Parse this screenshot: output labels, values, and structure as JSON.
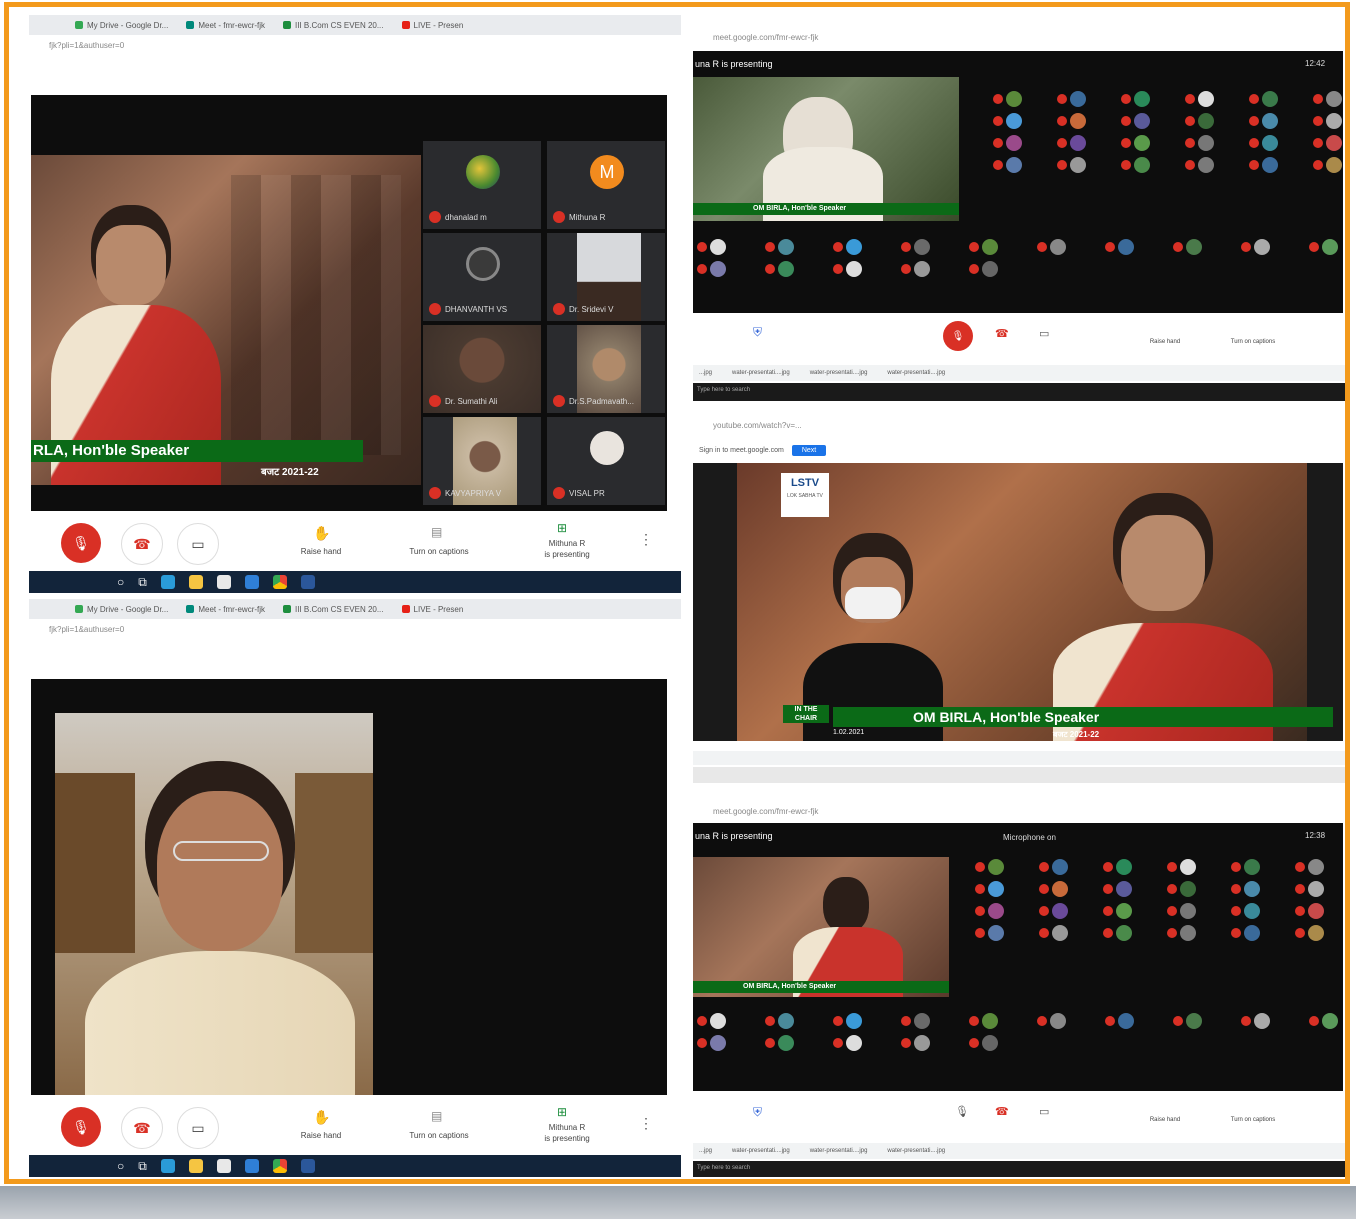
{
  "top_left": {
    "tabs": [
      {
        "label": "My Drive - Google Dr..."
      },
      {
        "label": "Meet - fmr-ewcr-fjk"
      },
      {
        "label": "III B.Com CS EVEN 20..."
      },
      {
        "label": "LIVE - Presen"
      }
    ],
    "url": "fjk?pli=1&authuser=0",
    "banner": "RLA, Hon'ble Speaker",
    "banner_sub": "बजट 2021-22",
    "participants": [
      {
        "name": "dhanalad m",
        "avatar": "globe-avatar",
        "color": "#4a8a2f"
      },
      {
        "name": "Mithuna R",
        "avatar": "letter-avatar",
        "letter": "M",
        "color": "#f28b1e"
      },
      {
        "name": "DHANVANTH VS",
        "avatar": "logo-avatar",
        "color": "#777"
      },
      {
        "name": "Dr. Sridevi V",
        "avatar": "photo-avatar",
        "color": "#8a7a66"
      },
      {
        "name": "Dr. Sumathi Ali",
        "avatar": "photo-avatar",
        "color": "#6a4a3a"
      },
      {
        "name": "Dr.S.Padmavath...",
        "avatar": "photo-avatar",
        "color": "#b08a6a"
      },
      {
        "name": "KAVYAPRIYA V",
        "avatar": "photo-avatar",
        "color": "#c8b8a0"
      },
      {
        "name": "VISAL PR",
        "avatar": "cartoon-avatar",
        "color": "#e9e4de"
      }
    ],
    "controls": {
      "raise_hand": "Raise hand",
      "captions": "Turn on captions",
      "presenting_line1": "Mithuna R",
      "presenting_line2": "is presenting"
    }
  },
  "top_right": {
    "url": "meet.google.com/fmr-ewcr-fjk",
    "presenting": "una R is presenting",
    "time": "12:42",
    "banner": "OM BIRLA, Hon'ble Speaker",
    "controls": {
      "raise_hand": "Raise hand",
      "captions": "Turn on captions"
    },
    "downloads": [
      "...jpg",
      "water-presentati....jpg",
      "water-presentati....jpg",
      "water-presentati....jpg"
    ],
    "search": "Type here to search"
  },
  "mid_right": {
    "url": "youtube.com/watch?v=...",
    "sign_in_text": "Sign in to meet.google.com",
    "sign_in_button": "Next",
    "logo": "LSTV",
    "logo_sub": "LOK SABHA TV",
    "chair": "IN THE CHAIR",
    "banner": "OM BIRLA, Hon'ble Speaker",
    "banner_sub": "बजट 2021-22",
    "date_label": "1.02.2021"
  },
  "bottom_left": {
    "tabs": [
      {
        "label": "My Drive - Google Dr..."
      },
      {
        "label": "Meet - fmr-ewcr-fjk"
      },
      {
        "label": "III B.Com CS EVEN 20..."
      },
      {
        "label": "LIVE - Presen"
      }
    ],
    "url": "fjk?pli=1&authuser=0",
    "controls": {
      "raise_hand": "Raise hand",
      "captions": "Turn on captions",
      "presenting_line1": "Mithuna R",
      "presenting_line2": "is presenting"
    }
  },
  "bottom_right": {
    "url": "meet.google.com/fmr-ewcr-fjk",
    "presenting": "una R is presenting",
    "time": "12:38",
    "mic_label": "Microphone on",
    "banner": "OM BIRLA, Hon'ble Speaker",
    "controls": {
      "raise_hand": "Raise hand",
      "captions": "Turn on captions"
    },
    "downloads": [
      "...jpg",
      "water-presentati....jpg",
      "water-presentati....jpg",
      "water-presentati....jpg"
    ],
    "search": "Type here to search"
  },
  "colors": {
    "frame": "#f39a1c",
    "red": "#d93025",
    "banner_green": "#0b6a17",
    "meet_black": "#0d0d0d"
  }
}
